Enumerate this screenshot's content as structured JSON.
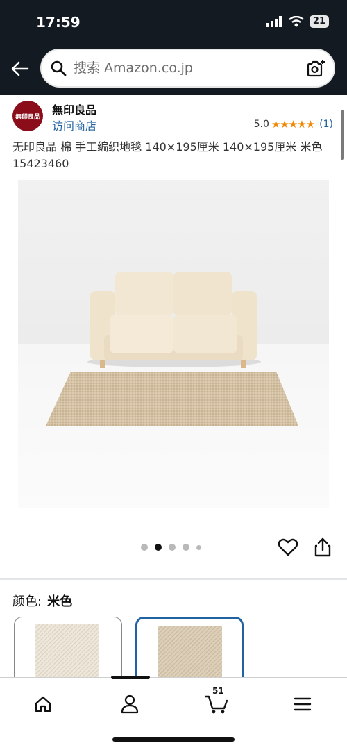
{
  "status": {
    "time": "17:59",
    "battery": "21"
  },
  "search": {
    "placeholder": "搜索 Amazon.co.jp"
  },
  "seller": {
    "logo_text": "無印良品",
    "name": "無印良品",
    "visit_store": "访问商店",
    "rating": "5.0",
    "stars": "★★★★★",
    "rating_count": "(1)"
  },
  "product": {
    "title": "无印良品 棉 手工编织地毯 140×195厘米 140×195厘米 米色 15423460",
    "image_index": 2,
    "image_total": 5
  },
  "variation": {
    "label": "颜色:",
    "value": "米色"
  },
  "nav": {
    "cart_count": "51"
  },
  "colors": {
    "header_bg": "#131a22",
    "link": "#2162a1",
    "star": "#f08804",
    "brand": "#8b0d1a"
  }
}
